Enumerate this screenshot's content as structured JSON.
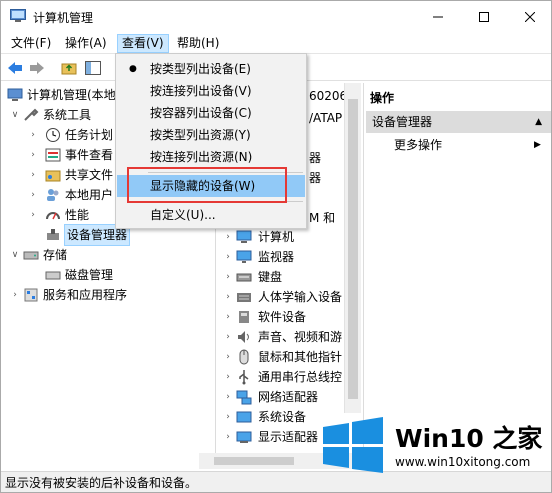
{
  "window": {
    "title": "计算机管理"
  },
  "menubar": [
    {
      "label": "文件(F)"
    },
    {
      "label": "操作(A)"
    },
    {
      "label": "查看(V)"
    },
    {
      "label": "帮助(H)"
    }
  ],
  "left_tree": [
    {
      "label": "计算机管理(本地"
    },
    {
      "label": "系统工具"
    },
    {
      "label": "任务计划"
    },
    {
      "label": "事件查看"
    },
    {
      "label": "共享文件"
    },
    {
      "label": "本地用户"
    },
    {
      "label": "性能"
    },
    {
      "label": "设备管理器"
    },
    {
      "label": "存储"
    },
    {
      "label": "磁盘管理"
    },
    {
      "label": "服务和应用程序"
    }
  ],
  "middle_fragments": [
    "60206",
    "/ATAP",
    "器",
    "器",
    "M 和"
  ],
  "device_list": [
    {
      "label": "计算机"
    },
    {
      "label": "监视器"
    },
    {
      "label": "键盘"
    },
    {
      "label": "人体学输入设备"
    },
    {
      "label": "软件设备"
    },
    {
      "label": "声音、视频和游"
    },
    {
      "label": "鼠标和其他指针"
    },
    {
      "label": "通用串行总线控"
    },
    {
      "label": "网络适配器"
    },
    {
      "label": "系统设备"
    },
    {
      "label": "显示适配器"
    }
  ],
  "dropdown": {
    "items": [
      {
        "label": "按类型列出设备(E)",
        "checked": true
      },
      {
        "label": "按连接列出设备(V)",
        "checked": false
      },
      {
        "label": "按容器列出设备(C)",
        "checked": false
      },
      {
        "label": "按类型列出资源(Y)",
        "checked": false
      },
      {
        "label": "按连接列出资源(N)",
        "checked": false
      },
      {
        "label": "显示隐藏的设备(W)",
        "checked": false
      },
      {
        "label": "自定义(U)...",
        "checked": false
      }
    ],
    "highlighted_color": "#91c9f7",
    "annotation_color": "#e53935"
  },
  "actions": {
    "header": "操作",
    "section": "设备管理器",
    "more": "更多操作"
  },
  "statusbar": {
    "text": "显示没有被安装的后补设备和设备。"
  },
  "watermark": {
    "title": "Win10 之家",
    "url": "www.win10xitong.com"
  }
}
